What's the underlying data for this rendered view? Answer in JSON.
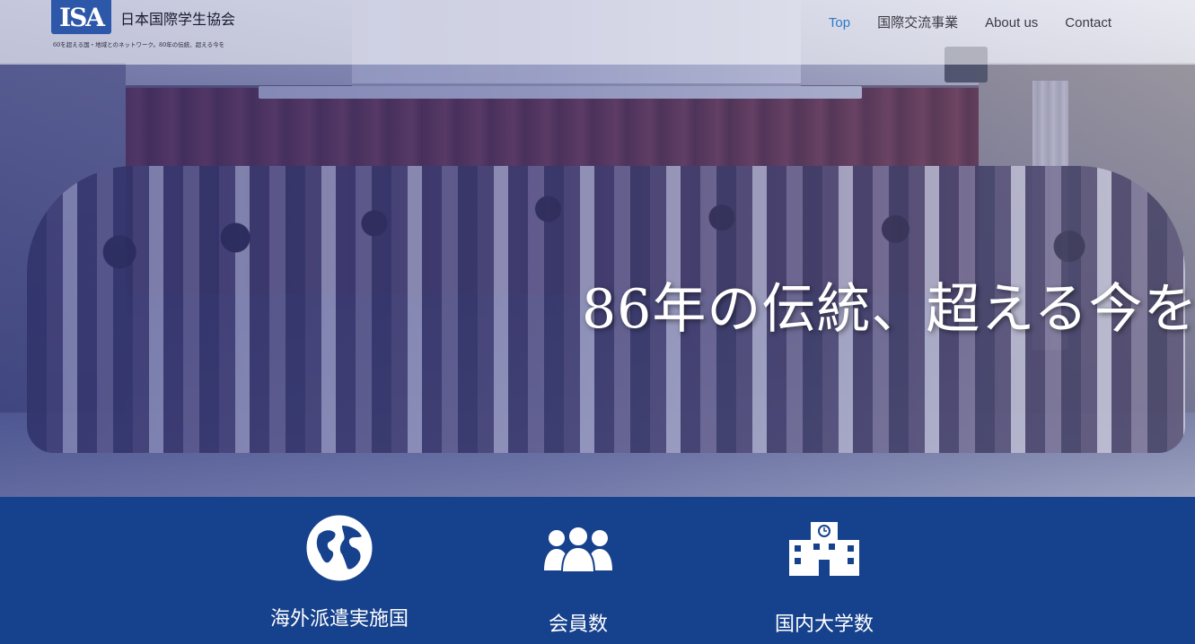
{
  "header": {
    "logo": {
      "mark": "ISA",
      "name": "日本国際学生協会",
      "tagline": "60を超える国・地域とのネットワーク。80年の伝統、超える今を"
    },
    "nav": [
      {
        "label": "Top",
        "active": true
      },
      {
        "label": "国際交流事業",
        "active": false
      },
      {
        "label": "About us",
        "active": false
      },
      {
        "label": "Contact",
        "active": false
      }
    ]
  },
  "hero": {
    "tagline": "86年の伝統、超える今を。"
  },
  "stats": [
    {
      "icon": "globe-icon",
      "label": "海外派遣実施国"
    },
    {
      "icon": "members-icon",
      "label": "会員数"
    },
    {
      "icon": "university-icon",
      "label": "国内大学数"
    }
  ],
  "colors": {
    "band_background": "#16418c",
    "nav_active": "#2b7ac9",
    "logo_blue": "#2d57a8"
  }
}
